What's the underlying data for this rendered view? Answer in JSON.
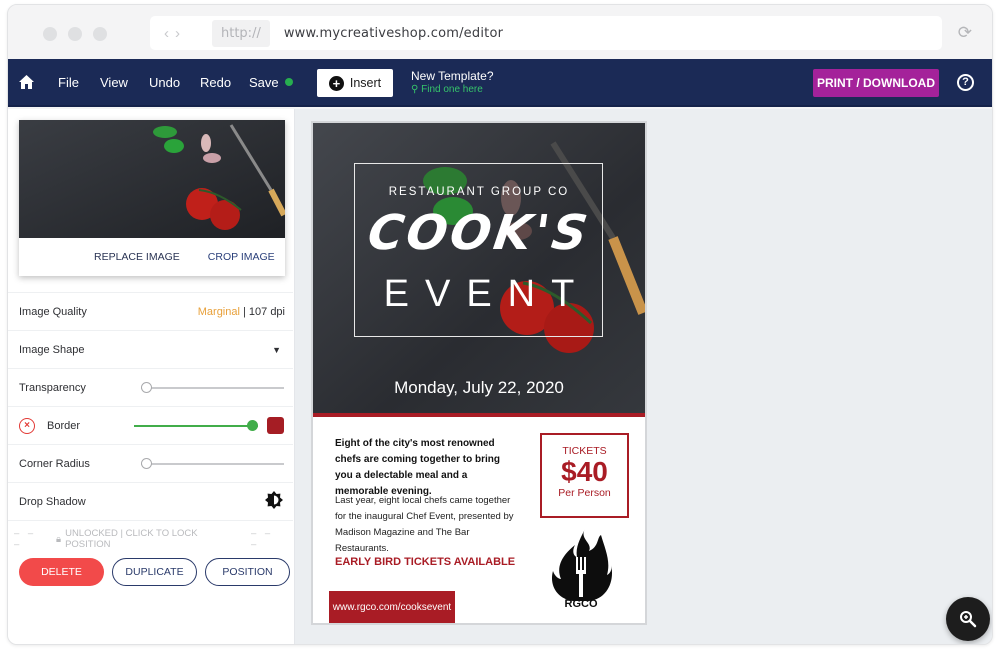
{
  "browser": {
    "protocol": "http://",
    "url": "www.mycreativeshop.com/editor"
  },
  "topnav": {
    "items": [
      "File",
      "View",
      "Undo",
      "Redo",
      "Save"
    ],
    "save_status_color": "#27ae4f",
    "insert_label": "Insert",
    "new_template_label": "New Template?",
    "find_label": "Find one here",
    "print_label": "PRINT / DOWNLOAD",
    "help_label": "?"
  },
  "sidebar": {
    "replace_image": "REPLACE IMAGE",
    "crop_image": "CROP IMAGE",
    "image_quality_label": "Image Quality",
    "image_quality_value": "Marginal",
    "image_quality_dpi": " | 107 dpi",
    "image_shape_label": "Image Shape",
    "transparency_label": "Transparency",
    "transparency_value": 0,
    "border_label": "Border",
    "border_value": 1.0,
    "border_color": "#a51d24",
    "corner_radius_label": "Corner Radius",
    "corner_radius_value": 0,
    "drop_shadow_label": "Drop Shadow",
    "lock_text": "UNLOCKED | CLICK TO LOCK POSITION",
    "buttons": {
      "delete": "DELETE",
      "duplicate": "DUPLICATE",
      "position": "POSITION"
    }
  },
  "flyer": {
    "company": "RESTAURANT GROUP CO",
    "title_line1": "COOK'S",
    "title_line2": "EVENT",
    "date": "Monday, July 22, 2020",
    "para1": "Eight of the city's most renowned chefs are coming together to bring you a delectable meal and a memorable evening.",
    "para2": "Last year, eight local chefs came together for the inaugural Chef Event, presented by Madison Magazine and The Bar Restaurants.",
    "early_bird": "EARLY BIRD TICKETS AVAILABLE",
    "website": "www.rgco.com/cooksevent",
    "tickets_label": "TICKETS",
    "price": "$40",
    "per_person": "Per Person",
    "logo_text": "RGCO",
    "accent_color": "#a91c25"
  }
}
